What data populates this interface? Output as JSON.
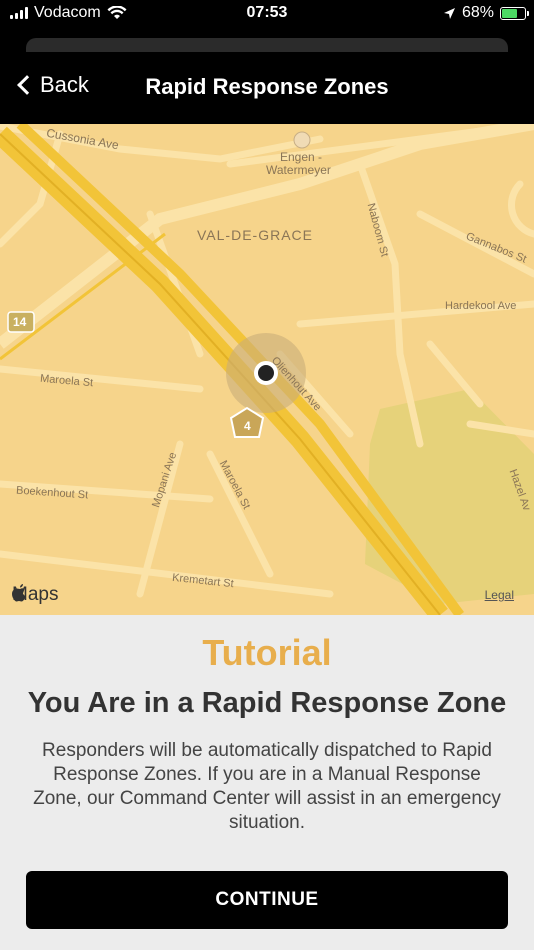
{
  "status_bar": {
    "carrier": "Vodacom",
    "time": "07:53",
    "battery_percent": "68%",
    "battery_level": 0.68,
    "icons": [
      "signal-icon",
      "wifi-icon",
      "location-arrow-icon",
      "battery-charging-icon"
    ]
  },
  "nav": {
    "back_label": "Back",
    "title": "Rapid Response Zones"
  },
  "map": {
    "labels": {
      "cussonia": "Cussonia Ave",
      "engen": "Engen -",
      "watermeyer": "Watermeyer",
      "val_de_grace": "VAL-DE-GRACE",
      "gannabos": "Gannabos St",
      "naboom": "Naboom St",
      "hardekool": "Hardekool Ave",
      "marula_st": "Maroela St",
      "olienhout": "Olienhout Ave",
      "boekenhout": "Boekenhout St",
      "mopani": "Mopani Ave",
      "maroela_diag": "Maroela St",
      "kremetart": "Kremetart St",
      "hazel": "Hazel Av",
      "route_14": "14",
      "route_n4": "4"
    },
    "maps_brand": "Maps",
    "legal": "Legal",
    "colors": {
      "land": "#f6d48b",
      "park": "#e6d27a",
      "highway": "#f2c438",
      "road": "#fbe3a8",
      "user_dot": "#222222"
    }
  },
  "tutorial": {
    "heading": "Tutorial",
    "title": "You Are in a Rapid Response Zone",
    "description": "Responders will be automatically dispatched to Rapid Response Zones. If you are in a Manual Response Zone, our Command Center will assist in an emergency situation.",
    "continue_label": "CONTINUE",
    "accent_color": "#e8ae4c"
  }
}
